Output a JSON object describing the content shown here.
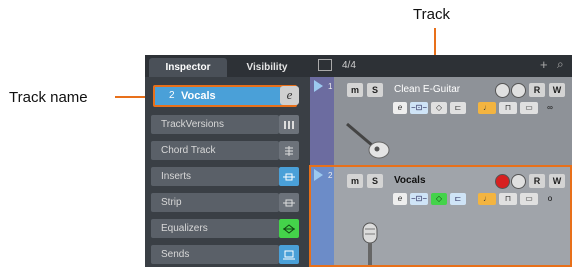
{
  "callouts": {
    "track_label": "Track",
    "track_name_label": "Track name"
  },
  "inspector": {
    "tabs": [
      "Inspector",
      "Visibility"
    ],
    "track_number": "2",
    "track_name": "Vocals",
    "sections": [
      "TrackVersions",
      "Chord Track",
      "Inserts",
      "Strip",
      "Equalizers",
      "Sends"
    ]
  },
  "tracklist": {
    "time_signature": "4/4",
    "tracks": [
      {
        "number": "1",
        "name": "Clean E-Guitar"
      },
      {
        "number": "2",
        "name": "Vocals"
      }
    ],
    "buttons": {
      "mute": "m",
      "solo": "S",
      "read": "R",
      "write": "W"
    }
  },
  "colors": {
    "accent": "#e8701a",
    "selected": "#4aa0d8",
    "eq_green": "#44d34a",
    "record_red": "#d82020"
  }
}
